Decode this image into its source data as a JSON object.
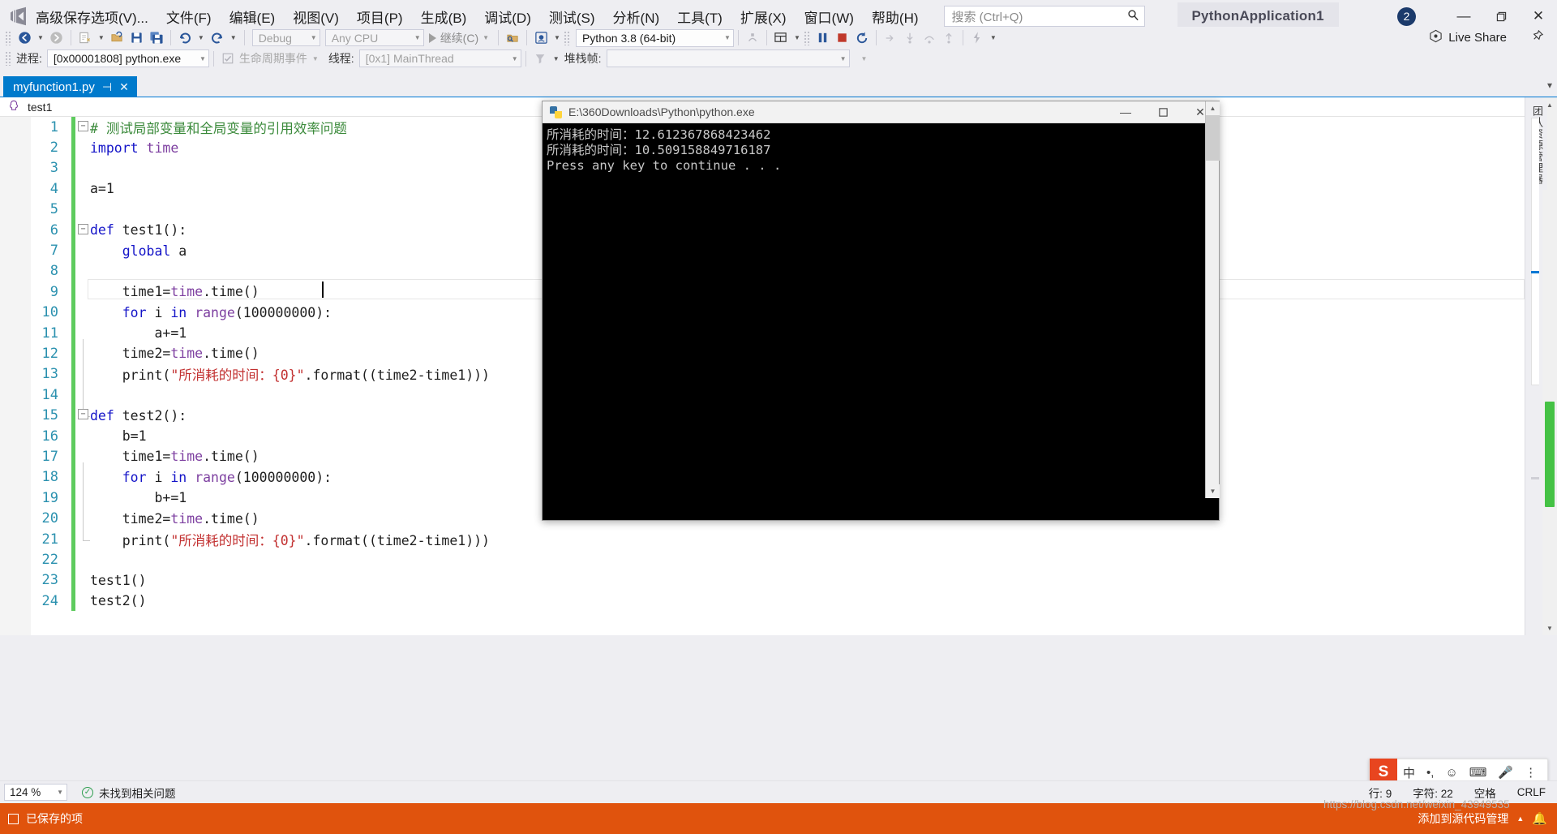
{
  "window": {
    "project_name": "PythonApplication1",
    "notification_count": "2",
    "minimize": "—",
    "maximize": "❐",
    "close": "✕"
  },
  "menubar": {
    "logo": "vs-logo-icon",
    "items": [
      "高级保存选项(V)...",
      "文件(F)",
      "编辑(E)",
      "视图(V)",
      "项目(P)",
      "生成(B)",
      "调试(D)",
      "测试(S)",
      "分析(N)",
      "工具(T)",
      "扩展(X)",
      "窗口(W)",
      "帮助(H)"
    ],
    "search_placeholder": "搜索 (Ctrl+Q)"
  },
  "toolbar": {
    "configuration": "Debug",
    "platform": "Any CPU",
    "continue_label": "继续(C)",
    "interpreter": "Python 3.8 (64-bit)",
    "live_share": "Live Share"
  },
  "debugbar": {
    "process_label": "进程:",
    "process_value": "[0x00001808] python.exe",
    "lifecycle_label": "生命周期事件",
    "thread_label": "线程:",
    "thread_value": "[0x1] MainThread",
    "stackframe_label": "堆栈帧:",
    "stackframe_value": ""
  },
  "tabs": {
    "active_file": "myfunction1.py",
    "pin": "⊣",
    "close": "✕"
  },
  "navbar": {
    "scope": "test1"
  },
  "editor": {
    "lines": [
      {
        "n": "1",
        "fold": "minus",
        "tokens": [
          {
            "t": "# 测试局部变量和全局变量的引用效率问题",
            "c": "tok-cmt"
          }
        ]
      },
      {
        "n": "2",
        "fold": "",
        "tokens": [
          {
            "t": "import",
            "c": "tok-kw"
          },
          {
            "t": " ",
            "c": "tok-txt"
          },
          {
            "t": "time",
            "c": "tok-mod"
          }
        ]
      },
      {
        "n": "3",
        "fold": "",
        "tokens": []
      },
      {
        "n": "4",
        "fold": "",
        "tokens": [
          {
            "t": "a=1",
            "c": "tok-txt"
          }
        ]
      },
      {
        "n": "5",
        "fold": "",
        "tokens": []
      },
      {
        "n": "6",
        "fold": "minus",
        "tokens": [
          {
            "t": "def",
            "c": "tok-kw"
          },
          {
            "t": " ",
            "c": "tok-txt"
          },
          {
            "t": "test1():",
            "c": "tok-txt"
          }
        ]
      },
      {
        "n": "7",
        "fold": "",
        "tokens": [
          {
            "t": "    ",
            "c": "tok-txt"
          },
          {
            "t": "global",
            "c": "tok-kw"
          },
          {
            "t": " a",
            "c": "tok-txt"
          }
        ]
      },
      {
        "n": "8",
        "fold": "",
        "tokens": []
      },
      {
        "n": "9",
        "fold": "",
        "tokens": [
          {
            "t": "    time1=",
            "c": "tok-txt"
          },
          {
            "t": "time",
            "c": "tok-mod"
          },
          {
            "t": ".time()",
            "c": "tok-txt"
          }
        ]
      },
      {
        "n": "10",
        "fold": "",
        "tokens": [
          {
            "t": "    ",
            "c": "tok-txt"
          },
          {
            "t": "for",
            "c": "tok-kw"
          },
          {
            "t": " i ",
            "c": "tok-txt"
          },
          {
            "t": "in",
            "c": "tok-kw"
          },
          {
            "t": " ",
            "c": "tok-txt"
          },
          {
            "t": "range",
            "c": "tok-mod"
          },
          {
            "t": "(100000000):",
            "c": "tok-txt"
          }
        ]
      },
      {
        "n": "11",
        "fold": "",
        "tokens": [
          {
            "t": "        a+=1",
            "c": "tok-txt"
          }
        ]
      },
      {
        "n": "12",
        "fold": "",
        "tokens": [
          {
            "t": "    time2=",
            "c": "tok-txt"
          },
          {
            "t": "time",
            "c": "tok-mod"
          },
          {
            "t": ".time()",
            "c": "tok-txt"
          }
        ]
      },
      {
        "n": "13",
        "fold": "",
        "tokens": [
          {
            "t": "    print(",
            "c": "tok-txt"
          },
          {
            "t": "\"所消耗的时间：{0}\"",
            "c": "tok-str"
          },
          {
            "t": ".format((time2-time1)))",
            "c": "tok-txt"
          }
        ]
      },
      {
        "n": "14",
        "fold": "",
        "tokens": []
      },
      {
        "n": "15",
        "fold": "minus",
        "tokens": [
          {
            "t": "def",
            "c": "tok-kw"
          },
          {
            "t": " ",
            "c": "tok-txt"
          },
          {
            "t": "test2():",
            "c": "tok-txt"
          }
        ]
      },
      {
        "n": "16",
        "fold": "",
        "tokens": [
          {
            "t": "    b=1",
            "c": "tok-txt"
          }
        ]
      },
      {
        "n": "17",
        "fold": "",
        "tokens": [
          {
            "t": "    time1=",
            "c": "tok-txt"
          },
          {
            "t": "time",
            "c": "tok-mod"
          },
          {
            "t": ".time()",
            "c": "tok-txt"
          }
        ]
      },
      {
        "n": "18",
        "fold": "",
        "tokens": [
          {
            "t": "    ",
            "c": "tok-txt"
          },
          {
            "t": "for",
            "c": "tok-kw"
          },
          {
            "t": " i ",
            "c": "tok-txt"
          },
          {
            "t": "in",
            "c": "tok-kw"
          },
          {
            "t": " ",
            "c": "tok-txt"
          },
          {
            "t": "range",
            "c": "tok-mod"
          },
          {
            "t": "(100000000):",
            "c": "tok-txt"
          }
        ]
      },
      {
        "n": "19",
        "fold": "",
        "tokens": [
          {
            "t": "        b+=1",
            "c": "tok-txt"
          }
        ]
      },
      {
        "n": "20",
        "fold": "",
        "tokens": [
          {
            "t": "    time2=",
            "c": "tok-txt"
          },
          {
            "t": "time",
            "c": "tok-mod"
          },
          {
            "t": ".time()",
            "c": "tok-txt"
          }
        ]
      },
      {
        "n": "21",
        "fold": "",
        "tokens": [
          {
            "t": "    print(",
            "c": "tok-txt"
          },
          {
            "t": "\"所消耗的时间：{0}\"",
            "c": "tok-str"
          },
          {
            "t": ".format((time2-time1)))",
            "c": "tok-txt"
          }
        ]
      },
      {
        "n": "22",
        "fold": "",
        "tokens": []
      },
      {
        "n": "23",
        "fold": "",
        "tokens": [
          {
            "t": "test1()",
            "c": "tok-txt"
          }
        ]
      },
      {
        "n": "24",
        "fold": "",
        "tokens": [
          {
            "t": "test2()",
            "c": "tok-txt"
          }
        ]
      }
    ]
  },
  "right_dock": {
    "tab_label": "团队资源管理器"
  },
  "console": {
    "title": "E:\\360Downloads\\Python\\python.exe",
    "minimize": "—",
    "maximize": "❐",
    "close": "✕",
    "output": "所消耗的时间：12.612367868423462\n所消耗的时间：10.509158849716187\nPress any key to continue . . ."
  },
  "statusbar": {
    "zoom": "124 %",
    "issues": "未找到相关问题",
    "ok_glyph": "✓",
    "line": "行: 9",
    "column": "字符: 22",
    "indent": "空格",
    "eol": "CRLF"
  },
  "bottombar": {
    "saved_text": "已保存的项",
    "add_to_source_control": "添加到源代码管理",
    "watermark": "https://blog.csdn.net/weixin_43949535"
  },
  "ime": {
    "logo": "S",
    "mode": "中",
    "items": [
      "中",
      "•,",
      "☺",
      "⌨",
      "🎤",
      "⋮"
    ]
  },
  "colors": {
    "accent": "#007acc",
    "tab_active_bg": "#007acc",
    "console_bg": "#000000",
    "orange_bar": "#e0530d",
    "change_bar": "#5ecb5e",
    "comment": "#3b8a3b",
    "keyword": "#1414c8",
    "string": "#c23030",
    "module": "#7d3fa0",
    "linenum": "#2b91af"
  }
}
